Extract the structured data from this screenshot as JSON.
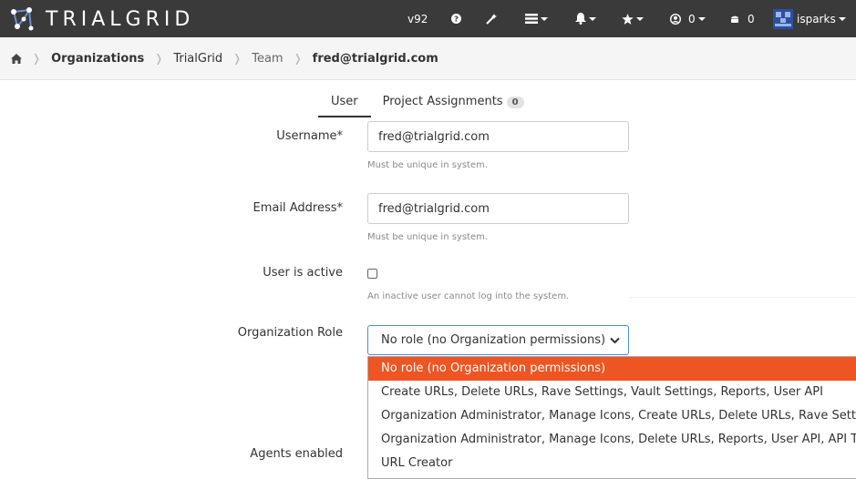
{
  "brand": {
    "name_left": "TRIAL",
    "name_right": "GRID"
  },
  "nav": {
    "version": "v92",
    "user_count": "0",
    "indicator_count": "0",
    "username": "isparks"
  },
  "breadcrumb": [
    {
      "label": "Organizations"
    },
    {
      "label": "TrialGrid"
    },
    {
      "label": "Team"
    },
    {
      "label": "fred@trialgrid.com"
    }
  ],
  "tabs": [
    {
      "label": "User"
    },
    {
      "label": "Project Assignments",
      "count": "0"
    }
  ],
  "form": {
    "username": {
      "label": "Username*",
      "value": "fred@trialgrid.com",
      "help": "Must be unique in system."
    },
    "email": {
      "label": "Email Address*",
      "value": "fred@trialgrid.com",
      "help": "Must be unique in system."
    },
    "active": {
      "label": "User is active",
      "checked": false,
      "help": "An inactive user cannot log into the system."
    },
    "role": {
      "label": "Organization Role",
      "selected": "No role (no Organization permissions)",
      "options": [
        "No role (no Organization permissions)",
        "Create URLs, Delete URLs, Rave Settings, Vault Settings, Reports, User API",
        "Organization Administrator, Manage Icons, Create URLs, Delete URLs, Rave Settings, Vault Settings, Reports, User API",
        "Organization Administrator, Manage Icons, Delete URLs, Reports, User API, API Tokens",
        "URL Creator"
      ]
    },
    "agents": {
      "label": "Agents enabled"
    }
  },
  "colors": {
    "topbar": "#3a3a3a",
    "accent": "#ee5522",
    "focus": "#4a90d9"
  }
}
